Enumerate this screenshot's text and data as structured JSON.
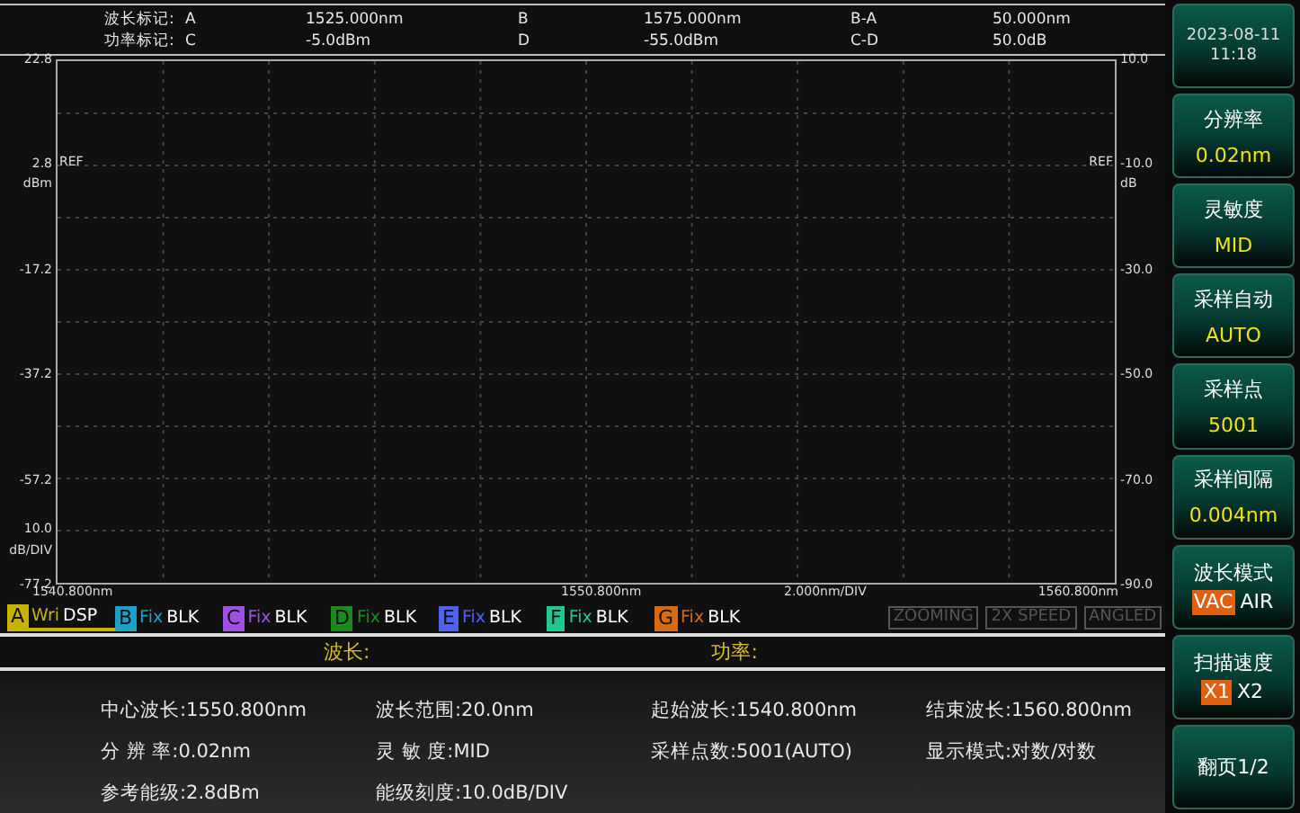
{
  "markers": [
    {
      "label": "波长标记:",
      "cells": [
        "A",
        "1525.000nm",
        "B",
        "1575.000nm",
        "B-A",
        "50.000nm"
      ]
    },
    {
      "label": "功率标记:",
      "cells": [
        "C",
        "-5.0dBm",
        "D",
        "-55.0dBm",
        "C-D",
        "50.0dB"
      ]
    }
  ],
  "plot": {
    "left_ticks": [
      "22.8",
      "2.8",
      "-17.2",
      "-37.2",
      "-57.2",
      "-77.2"
    ],
    "left_unit": "dBm",
    "left_scale": "10.0",
    "left_scale_unit": "dB/DIV",
    "right_ticks": [
      "10.0",
      "-10.0",
      "-30.0",
      "-50.0",
      "-70.0",
      "-90.0"
    ],
    "right_unit": "dB",
    "ref_left": "REF",
    "ref_right": "REF",
    "x_start": "1540.800nm",
    "x_center": "1550.800nm",
    "x_scale": "2.000nm/DIV",
    "x_end": "1560.800nm"
  },
  "traces": [
    {
      "letter": "A",
      "mode": "Wri",
      "state": "DSP",
      "color": "#c8b400",
      "selected": true
    },
    {
      "letter": "B",
      "mode": "Fix",
      "state": "BLK",
      "color": "#1ca0c8",
      "selected": false
    },
    {
      "letter": "C",
      "mode": "Fix",
      "state": "BLK",
      "color": "#a050e0",
      "selected": false
    },
    {
      "letter": "D",
      "mode": "Fix",
      "state": "BLK",
      "color": "#1a8a1a",
      "selected": false
    },
    {
      "letter": "E",
      "mode": "Fix",
      "state": "BLK",
      "color": "#5060f0",
      "selected": false
    },
    {
      "letter": "F",
      "mode": "Fix",
      "state": "BLK",
      "color": "#20c890",
      "selected": false
    },
    {
      "letter": "G",
      "mode": "Fix",
      "state": "BLK",
      "color": "#d86a10",
      "selected": false
    }
  ],
  "status_flags": [
    {
      "label": "ZOOMING",
      "on": false
    },
    {
      "label": "2X SPEED",
      "on": false
    },
    {
      "label": "ANGLED",
      "on": false
    }
  ],
  "readout": {
    "wavelength_label": "波长:",
    "power_label": "功率:"
  },
  "info": [
    "中心波长:1550.800nm",
    "波长范围:20.0nm",
    "起始波长:1540.800nm",
    "结束波长:1560.800nm",
    "分 辨 率:0.02nm",
    "灵 敏 度:MID",
    "采样点数:5001(AUTO)",
    "显示模式:对数/对数",
    "参考能级:2.8dBm",
    "能级刻度:10.0dB/DIV"
  ],
  "softkeys": [
    {
      "kind": "clock",
      "date": "2023-08-11",
      "time": "11:18"
    },
    {
      "kind": "value",
      "title": "分辨率",
      "value": "0.02nm"
    },
    {
      "kind": "value",
      "title": "灵敏度",
      "value": "MID"
    },
    {
      "kind": "value",
      "title": "采样自动",
      "value": "AUTO"
    },
    {
      "kind": "value",
      "title": "采样点",
      "value": "5001"
    },
    {
      "kind": "value",
      "title": "采样间隔",
      "value": "0.004nm"
    },
    {
      "kind": "toggle",
      "title": "波长模式",
      "options": [
        {
          "label": "VAC",
          "selected": true
        },
        {
          "label": "AIR",
          "selected": false
        }
      ]
    },
    {
      "kind": "toggle",
      "title": "扫描速度",
      "options": [
        {
          "label": "X1",
          "selected": true
        },
        {
          "label": "X2",
          "selected": false
        }
      ]
    },
    {
      "kind": "plain",
      "title": "翻页1/2"
    }
  ]
}
